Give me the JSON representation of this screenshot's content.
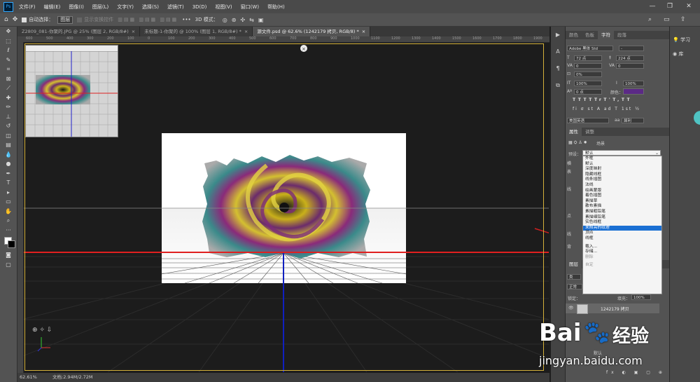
{
  "app": {
    "logo": "Ps"
  },
  "menu": [
    "文件(F)",
    "编辑(E)",
    "图像(I)",
    "图层(L)",
    "文字(Y)",
    "选择(S)",
    "滤镜(T)",
    "3D(D)",
    "视图(V)",
    "窗口(W)",
    "帮助(H)"
  ],
  "options": {
    "auto_select_label": "自动选择：",
    "auto_select_value": "图层",
    "show_transform": "显示变换控件",
    "mode_3d": "3D 模式："
  },
  "tabs": [
    {
      "label": "Z2809_081-你聚的.JPG @ 25% (图层 2, RGB/8#)",
      "active": false
    },
    {
      "label": "未标题-1-你聚的 @ 100% (图层 1, RGB/8#) *",
      "active": false
    },
    {
      "label": "源文件.psd @ 62.6% (1242179 拷贝, RGB/8) *",
      "active": true
    }
  ],
  "ruler_ticks": [
    "600",
    "500",
    "400",
    "300",
    "200",
    "100",
    "0",
    "100",
    "200",
    "300",
    "400",
    "500",
    "600",
    "700",
    "800",
    "900",
    "1000",
    "1100",
    "1200",
    "1300",
    "1400",
    "1500",
    "1600",
    "1700",
    "1800",
    "1900"
  ],
  "status": {
    "zoom": "62.61%",
    "doc": "文档:2.94M/2.72M"
  },
  "char_panel": {
    "tabs": [
      "颜色",
      "色板",
      "字符",
      "段落"
    ],
    "active_tab": "字符",
    "font": "Adobe 黑体 Std",
    "font_style": "-",
    "size": "72 点",
    "leading": "224 点",
    "kerning": "0",
    "tracking": "0",
    "scale_pct": "0%",
    "vscale": "100%",
    "hscale": "100%",
    "baseline": "0 点",
    "color_label": "颜色：",
    "color": "#5b2a86",
    "lang": "美国英语",
    "aa": "犀利",
    "style_buttons": [
      "T",
      "T",
      "TT",
      "Tr",
      "T'",
      "T,",
      "T",
      "T"
    ],
    "ot_buttons": [
      "fi",
      "σ",
      "st",
      "A",
      "ad",
      "T",
      "1st",
      "½"
    ]
  },
  "props_panel": {
    "tabs": [
      "属性",
      "调整"
    ],
    "active_tab": "属性",
    "scene": "场景",
    "preset_label": "预设：",
    "preset_value": "默认",
    "left_labels": [
      "横",
      "表",
      "线",
      "点",
      "线",
      "背"
    ]
  },
  "preset_options": [
    {
      "label": "外框",
      "state": "normal"
    },
    {
      "label": "默认",
      "state": "normal"
    },
    {
      "label": "深度映射",
      "state": "normal"
    },
    {
      "label": "隐藏线框",
      "state": "normal"
    },
    {
      "label": "线条插图",
      "state": "normal"
    },
    {
      "label": "法线",
      "state": "normal"
    },
    {
      "label": "绘画蒙版",
      "state": "normal"
    },
    {
      "label": "着色插图",
      "state": "normal"
    },
    {
      "label": "素描草",
      "state": "normal"
    },
    {
      "label": "散布素描",
      "state": "normal"
    },
    {
      "label": "素描粗铅笔",
      "state": "normal"
    },
    {
      "label": "素描细铅笔",
      "state": "normal"
    },
    {
      "label": "实色线框",
      "state": "normal"
    },
    {
      "label": "未照亮的纹理",
      "state": "highlighted"
    },
    {
      "label": "顶点",
      "state": "normal"
    },
    {
      "label": "线框",
      "state": "normal"
    }
  ],
  "preset_actions": [
    {
      "label": "载入...",
      "state": "normal"
    },
    {
      "label": "存储...",
      "state": "normal"
    },
    {
      "label": "删除",
      "state": "disabled"
    },
    {
      "label": "自定",
      "state": "disabled"
    }
  ],
  "layers_panel": {
    "tab": "图层",
    "kind_label": "类",
    "blend": "正常",
    "lock_label": "锁定：",
    "fill_label": "填充：",
    "fill_value": "100%",
    "layer_name": "1242179 拷贝",
    "sub_label": "默认"
  },
  "far_right": {
    "learn": "学习",
    "library": "库"
  },
  "watermark": {
    "text": "Bai",
    "text2": "经验",
    "url": "jingyan.baidu.com"
  }
}
